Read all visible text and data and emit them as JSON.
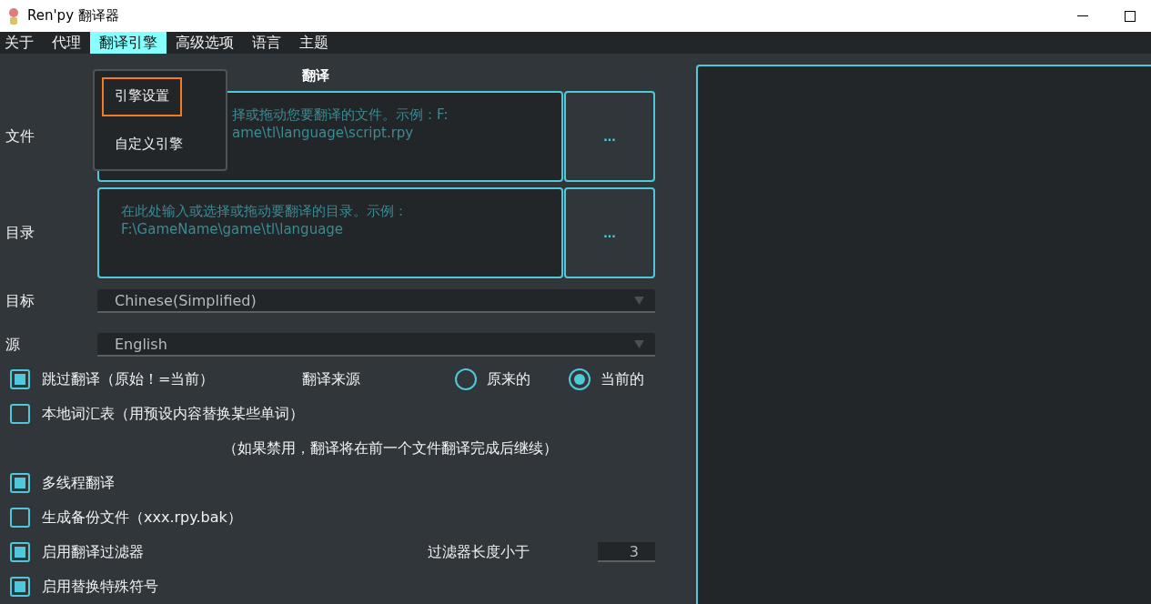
{
  "window": {
    "title": "Ren'py 翻译器"
  },
  "menu": [
    {
      "label": "关于",
      "selected": false
    },
    {
      "label": "代理",
      "selected": false
    },
    {
      "label": "翻译引擎",
      "selected": true
    },
    {
      "label": "高级选项",
      "selected": false
    },
    {
      "label": "语言",
      "selected": false
    },
    {
      "label": "主题",
      "selected": false
    }
  ],
  "dropdown": {
    "items": [
      {
        "label": "引擎设置",
        "selected": true
      },
      {
        "label": "自定义引擎",
        "selected": false
      }
    ]
  },
  "form": {
    "title": "翻译",
    "file": {
      "label": "文件",
      "placeholder": "择或拖动您要翻译的文件。示例：F:\name\\tl\\language\\script.rpy",
      "button": "..."
    },
    "directory": {
      "label": "目录",
      "placeholder": "在此处输入或选择或拖动要翻译的目录。示例：F:\\GameName\\game\\tl\\language",
      "button": "..."
    },
    "target": {
      "label": "目标",
      "value": "Chinese(Simplified)"
    },
    "source": {
      "label": "源",
      "value": "English"
    }
  },
  "options": [
    {
      "kind": "checkbox",
      "label": "跳过翻译（原始！=当前）",
      "checked": true,
      "extra": {
        "kind": "radios",
        "label": "翻译来源",
        "choices": [
          {
            "label": "原来的",
            "selected": false
          },
          {
            "label": "当前的",
            "selected": true
          }
        ]
      }
    },
    {
      "kind": "checkbox",
      "label": "本地词汇表（用预设内容替换某些单词）",
      "checked": false
    },
    {
      "kind": "note",
      "label": "（如果禁用，翻译将在前一个文件翻译完成后继续）"
    },
    {
      "kind": "checkbox",
      "label": "多线程翻译",
      "checked": true
    },
    {
      "kind": "checkbox",
      "label": "生成备份文件（xxx.rpy.bak）",
      "checked": false
    },
    {
      "kind": "checkbox",
      "label": "启用翻译过滤器",
      "checked": true,
      "extra": {
        "kind": "number",
        "label": "过滤器长度小于",
        "value": "3"
      }
    },
    {
      "kind": "checkbox",
      "label": "启用替换特殊符号",
      "checked": true
    }
  ]
}
